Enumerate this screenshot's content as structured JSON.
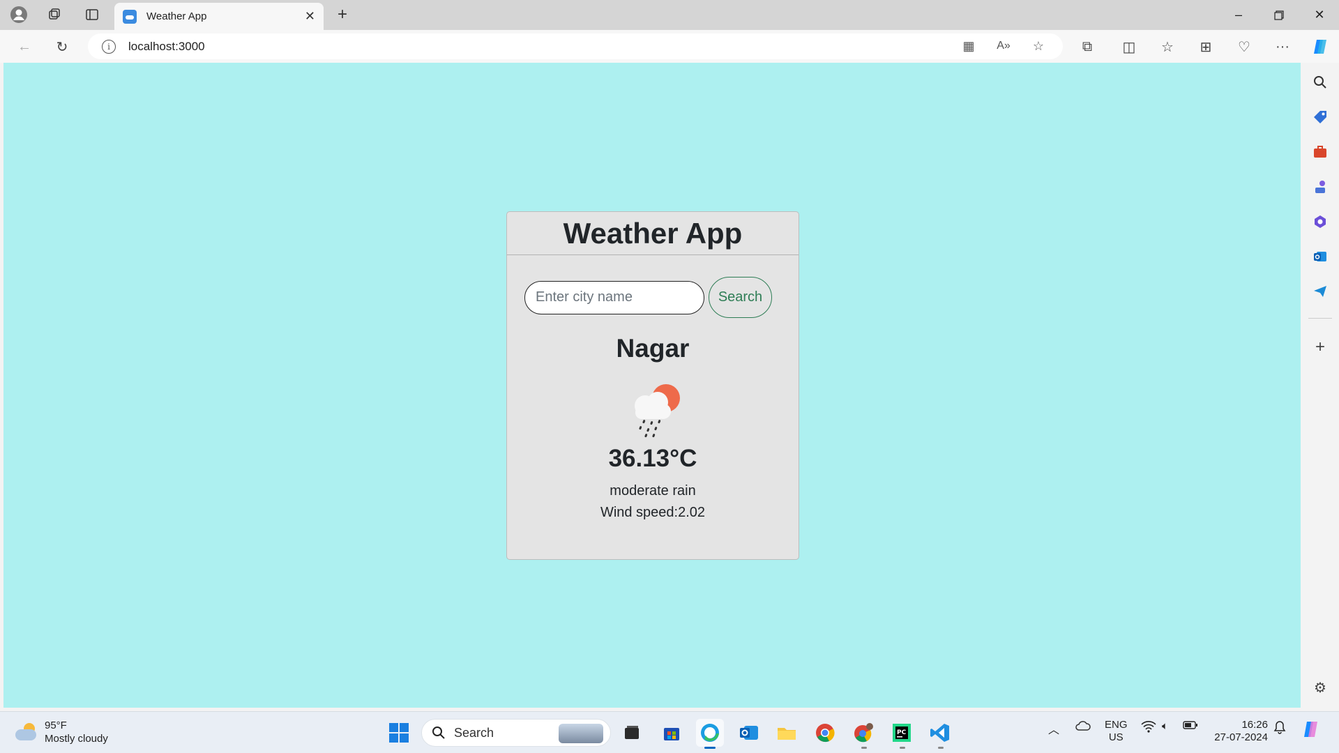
{
  "browser": {
    "tab_title": "Weather App",
    "url": "localhost:3000"
  },
  "app": {
    "title": "Weather App",
    "search_placeholder": "Enter city name",
    "search_value": "",
    "search_button": "Search",
    "city": "Nagar",
    "weather_icon": "rain-cloud-sun-icon",
    "temperature": "36.13°C",
    "description": "moderate rain",
    "wind": "Wind speed:2.02"
  },
  "taskbar": {
    "weather_temp": "95°F",
    "weather_desc": "Mostly cloudy",
    "search_label": "Search",
    "lang_top": "ENG",
    "lang_bottom": "US",
    "time": "16:26",
    "date": "27-07-2024"
  },
  "colors": {
    "page_background": "#adf0f0",
    "card_background": "#e4e4e4",
    "search_button": "#2e7d55",
    "accent": "#0067c0"
  }
}
